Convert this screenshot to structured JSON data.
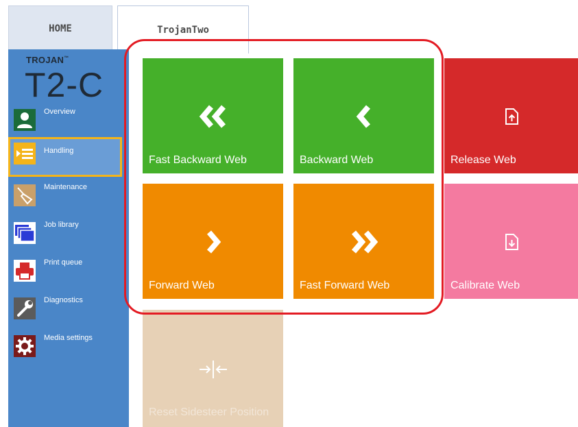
{
  "tabs": [
    {
      "label": "HOME"
    },
    {
      "label": "TrojanTwo"
    }
  ],
  "brand": {
    "small": "TROJAN",
    "tm": "™",
    "big": "T2-C"
  },
  "sidebar": {
    "items": [
      {
        "label": "Overview",
        "icon": "person-icon",
        "color": "#1b6b3a"
      },
      {
        "label": "Handling",
        "icon": "list-icon",
        "color": "#f4b41a"
      },
      {
        "label": "Maintenance",
        "icon": "broom-icon",
        "color": "#c9a06a"
      },
      {
        "label": "Job library",
        "icon": "stack-icon",
        "color": "#2a3bd6"
      },
      {
        "label": "Print queue",
        "icon": "printer-icon",
        "color": "#d5292a"
      },
      {
        "label": "Diagnostics",
        "icon": "wrench-icon",
        "color": "#5b5b5b"
      },
      {
        "label": "Media settings",
        "icon": "gear-icon",
        "color": "#7a1a1a"
      }
    ],
    "selected": "Handling"
  },
  "tiles": [
    {
      "label": "Fast Backward Web",
      "icon": "double-chevron-left-icon",
      "color": "#45b02a"
    },
    {
      "label": "Backward Web",
      "icon": "chevron-left-icon",
      "color": "#45b02a"
    },
    {
      "label": "Release Web",
      "icon": "document-up-icon",
      "color": "#d5292a"
    },
    {
      "label": "Forward Web",
      "icon": "chevron-right-icon",
      "color": "#f08a00"
    },
    {
      "label": "Fast Forward Web",
      "icon": "double-chevron-right-icon",
      "color": "#f08a00"
    },
    {
      "label": "Calibrate Web",
      "icon": "document-down-icon",
      "color": "#f47aa0"
    },
    {
      "label": "Reset Sidesteer Position",
      "icon": "converge-arrows-icon",
      "color": "#e7d1b6"
    }
  ],
  "highlight_color": "#e31b23"
}
